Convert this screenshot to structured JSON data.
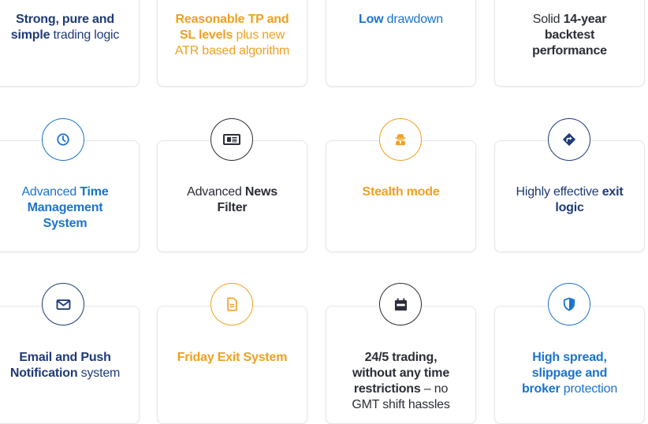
{
  "colors": {
    "navy": "#1e3a78",
    "orange": "#f0a020",
    "blue": "#1a73d0",
    "dark": "#2b2d38"
  },
  "features": [
    {
      "icon": null,
      "color": "navy",
      "bold": "Strong, pure and simple",
      "rest": " trading logic"
    },
    {
      "icon": null,
      "color": "orange",
      "bold": "Reasonable TP and SL levels",
      "rest": " plus new ATR based algorithm"
    },
    {
      "icon": null,
      "color": "blue",
      "bold": "Low",
      "rest": " drawdown"
    },
    {
      "icon": null,
      "color": "dark",
      "pre": "Solid ",
      "bold": "14-year backtest performance",
      "rest": ""
    },
    {
      "icon": "clock-icon",
      "color": "blue",
      "pre": "Advanced ",
      "bold": "Time Management System",
      "rest": ""
    },
    {
      "icon": "newspaper-icon",
      "color": "dark",
      "pre": "Advanced ",
      "bold": "News Filter",
      "rest": ""
    },
    {
      "icon": "spy-icon",
      "color": "orange",
      "bold": "Stealth mode",
      "rest": ""
    },
    {
      "icon": "directions-icon",
      "color": "navy",
      "pre": "Highly effective ",
      "bold": "exit logic",
      "rest": ""
    },
    {
      "icon": "envelope-icon",
      "color": "navy",
      "bold": "Email and Push Notification",
      "rest": " system"
    },
    {
      "icon": "file-icon",
      "color": "orange",
      "bold": "Friday Exit System",
      "rest": ""
    },
    {
      "icon": "calendar-icon",
      "color": "dark",
      "bold": "24/5 trading, without any time restrictions",
      "rest": " – no GMT shift hassles"
    },
    {
      "icon": "shield-icon",
      "color": "blue",
      "bold": "High spread, slippage and broker",
      "rest": " protection"
    }
  ]
}
